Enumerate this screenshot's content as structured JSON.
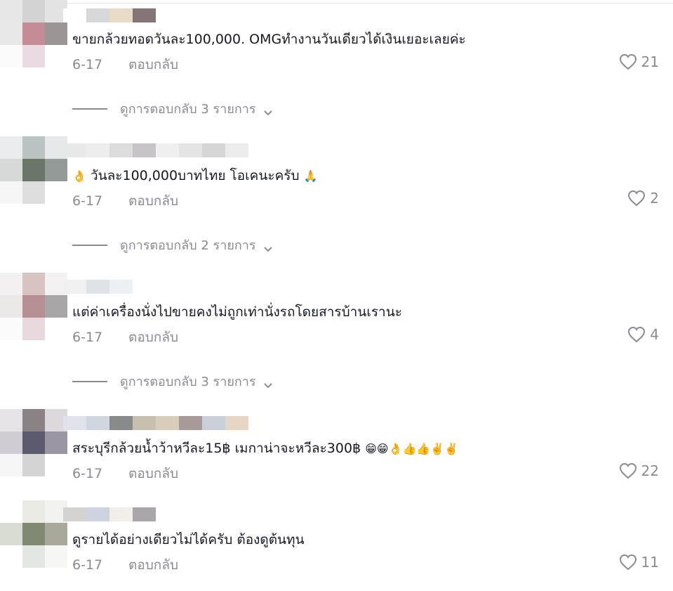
{
  "comments": [
    {
      "text": "ขายกล้วยทอดวันละ100,000. OMGทำงานวันเดียวได้เงินเยอะเลยค่ะ",
      "emoji_pre": "",
      "emoji_post": "",
      "date": "6-17",
      "reply": "ตอบกลับ",
      "likes": "21",
      "view_replies": "ดูการตอบกลับ 3 รายการ",
      "avatar_colors": [
        "#e6e6e6",
        "#d2d2d2",
        "#e3e3e3",
        "#e8e8e8",
        "#c48c94",
        "#9b9596",
        "#fafafa",
        "#eadbe2",
        "#ffffff"
      ],
      "username_colors": [
        "#ffffff",
        "#d8d8da",
        "#e8dcc8",
        "#857577",
        "#ffffff"
      ]
    },
    {
      "text": "วันละ100,000บาทไทย โอเคนะครับ",
      "emoji_pre": "👌",
      "emoji_post": "🙏",
      "date": "6-17",
      "reply": "ตอบกลับ",
      "likes": "2",
      "view_replies": "ดูการตอบกลับ 2 รายการ",
      "avatar_colors": [
        "#e8ecec",
        "#b7c4c2",
        "#e6e9ea",
        "#d4d9d8",
        "#6b7766",
        "#949a97",
        "#f4f5f4",
        "#dedede",
        "#ffffff"
      ],
      "username_colors": [
        "#e8e8e8",
        "#ededed",
        "#dcdcdc",
        "#c6c4c6",
        "#efefef",
        "#e4e4e4",
        "#d6d6d6",
        "#ececec"
      ]
    },
    {
      "text": "แต่ค่าเครื่องนั่งไปขายคงไม่ถูกเท่านั่งรถโดยสารบ้านเรานะ",
      "emoji_pre": "",
      "emoji_post": "",
      "date": "6-17",
      "reply": "ตอบกลับ",
      "likes": "4",
      "view_replies": "ดูการตอบกลับ 3 รายการ",
      "avatar_colors": [
        "#f2f0f0",
        "#d9c3c0",
        "#f3f1f1",
        "#ede8e8",
        "#b58f92",
        "#aaa6a8",
        "#fafafa",
        "#e9d9df",
        "#ffffff"
      ],
      "username_colors": [
        "#f0f0f0",
        "#dde2e6",
        "#eaf0f4",
        "#ffffff"
      ]
    },
    {
      "text": "สระบุรีกล้วยน้ำว้าหวีละ15฿ เมกาน่าจะหวีละ300฿",
      "emoji_pre": "",
      "emoji_post": "😁😁👌👍👍✌️✌️",
      "date": "6-17",
      "reply": "ตอบกลับ",
      "likes": "22",
      "view_replies": "",
      "avatar_colors": [
        "#e6e4e6",
        "#8b8286",
        "#dcd9de",
        "#cfcdd3",
        "#5a5c6d",
        "#9b96a1",
        "#f5f5f5",
        "#d4d4d4",
        "#ffffff"
      ],
      "username_colors": [
        "#e0e3ea",
        "#cfd6e0",
        "#888a8c",
        "#c9bfb1",
        "#d8cdbb",
        "#a89a99",
        "#c9d0d8",
        "#e8d6c4"
      ]
    },
    {
      "text": "ดูรายได้อย่างเดียวไม่ได้ครับ ต้องดูต้นทุน",
      "emoji_pre": "",
      "emoji_post": "",
      "date": "6-17",
      "reply": "ตอบกลับ",
      "likes": "11",
      "view_replies": "",
      "avatar_colors": [
        "#ffffff",
        "#e9ebe4",
        "#f2f2ee",
        "#d8dcd2",
        "#808973",
        "#a8a89b",
        "#ffffff",
        "#e4e6e2",
        "#f6f6f4"
      ],
      "username_colors": [
        "#d5d3d2",
        "#ccd3de",
        "#f1efea",
        "#aaa6ab"
      ]
    }
  ]
}
